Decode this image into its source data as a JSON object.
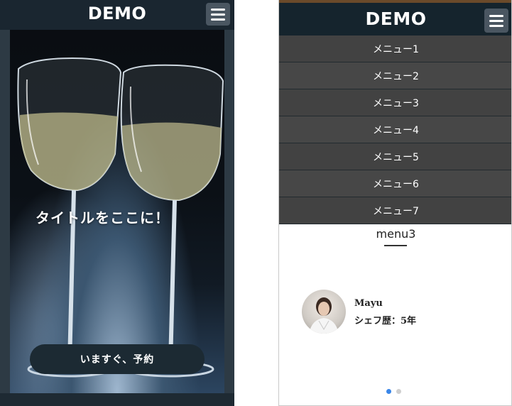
{
  "left_screen": {
    "brand": "DEMO",
    "hero_title": "タイトルをここに！",
    "cta_label": "いますぐ、予約"
  },
  "right_screen": {
    "brand": "DEMO",
    "menu_items": [
      "メニュー1",
      "メニュー2",
      "メニュー3",
      "メニュー4",
      "メニュー5",
      "メニュー6",
      "メニュー7"
    ],
    "section_title": "menu3",
    "chef": {
      "name": "Mayu",
      "career": "シェフ歴：5年"
    },
    "carousel_dots": 2,
    "active_dot": 1
  },
  "colors": {
    "header": "#15242d",
    "menu_overlay": "#3c3c3c",
    "cta": "#1c2a33",
    "active_dot": "#3a86e8"
  },
  "icons": [
    "hamburger-menu-icon"
  ]
}
